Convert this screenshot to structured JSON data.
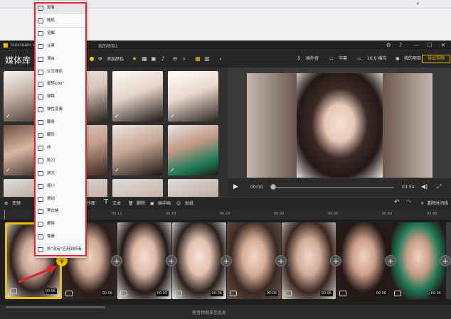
{
  "window": {
    "app_title": "Icecream V...",
    "project_title": "我的项目1",
    "controls": {
      "settings": "⚙",
      "help": "?",
      "minimize": "—",
      "maximize": "☐",
      "close": "✕"
    }
  },
  "library": {
    "title": "媒体库",
    "add_media": "添加颜色"
  },
  "right_toolbar": {
    "narration": "画外音",
    "subtitles": "字幕",
    "aspect": "16:9 横向",
    "my_projects": "我的项目",
    "export": "导出视频"
  },
  "preview": {
    "time_current": "00:00",
    "time_total": "03:54",
    "progress": 0.0
  },
  "edit_toolbar": {
    "transition": "变频",
    "action": "作图",
    "text": "文本",
    "delete": "删除",
    "screen": "画中画",
    "audio": "贴纸",
    "clear_timeline": "清除时间线"
  },
  "ruler": {
    "ticks": [
      "00:12",
      "00:18",
      "00:24",
      "00:30",
      "00:36",
      "00:42",
      "00:48",
      "00:54"
    ]
  },
  "timeline": {
    "durations": [
      "00:06",
      "00:06",
      "00:05",
      "00:06",
      "00:06",
      "00:06",
      "00:06",
      "00:06",
      "00:06"
    ],
    "drop_hint": "拖音频拖放至此处"
  },
  "menu": {
    "items": [
      {
        "label": "没有",
        "icon": "no-icon"
      },
      {
        "label": "随机",
        "icon": "random-icon"
      },
      {
        "label": "溶解",
        "icon": "dissolve-icon"
      },
      {
        "label": "淡黑",
        "icon": "fade-black-icon"
      },
      {
        "label": "滑台",
        "icon": "slide-icon"
      },
      {
        "label": "交叉褪色",
        "icon": "cross-fade-icon"
      },
      {
        "label": "旋转180°",
        "icon": "rotate-icon"
      },
      {
        "label": "弹跳",
        "icon": "bounce-icon"
      },
      {
        "label": "弹性变奏",
        "icon": "elastic-icon"
      },
      {
        "label": "翻身",
        "icon": "flip-icon"
      },
      {
        "label": "翻页",
        "icon": "page-turn-icon"
      },
      {
        "label": "线",
        "icon": "line-icon"
      },
      {
        "label": "剪刀",
        "icon": "scissors-icon"
      },
      {
        "label": "放大",
        "icon": "zoom-in-icon"
      },
      {
        "label": "缩小",
        "icon": "zoom-out-icon"
      },
      {
        "label": "滑动",
        "icon": "swipe-icon"
      },
      {
        "label": "黑白格",
        "icon": "checker-icon"
      },
      {
        "label": "擦除",
        "icon": "wipe-icon"
      },
      {
        "label": "像素",
        "icon": "pixel-icon"
      },
      {
        "label": "将\"没有\"应用到所有",
        "icon": "apply-all-icon"
      }
    ]
  },
  "colors": {
    "accent": "#f0c000",
    "highlight": "#e0252a"
  }
}
